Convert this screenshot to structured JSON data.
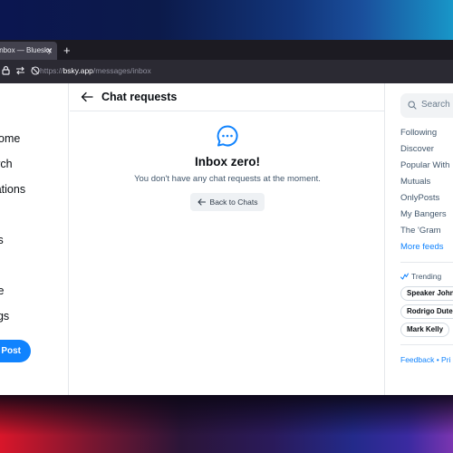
{
  "browser": {
    "tab_title": "Inbox — Bluesky",
    "tab_close": "✕",
    "new_tab": "+",
    "url_prefix": "https://",
    "url_domain": "bsky.app",
    "url_path": "/messages/inbox"
  },
  "leftnav": {
    "items": [
      {
        "label": "Home",
        "visible": "e"
      },
      {
        "label": "Search",
        "visible": "ch"
      },
      {
        "label": "Notifications",
        "visible": "ications"
      },
      {
        "label": "Feeds",
        "visible": "s"
      },
      {
        "label": "Profile",
        "visible": "le"
      },
      {
        "label": "Settings",
        "visible": "ngs"
      }
    ],
    "post_button": "Post"
  },
  "main": {
    "header_title": "Chat requests",
    "empty_title": "Inbox zero!",
    "empty_subtitle": "You don't have any chat requests at the moment.",
    "back_button": "Back to Chats"
  },
  "rightcol": {
    "search_placeholder": "Search",
    "feeds": [
      "Following",
      "Discover",
      "Popular With",
      "Mutuals",
      "OnlyPosts",
      "My Bangers",
      "The 'Gram"
    ],
    "more_feeds": "More feeds",
    "trending_label": "Trending",
    "trending": [
      "Speaker John",
      "Rodrigo Dute",
      "Mark Kelly"
    ],
    "footer": "Feedback • Pri"
  },
  "colors": {
    "accent": "#1083fe",
    "text": "#0b0f14",
    "muted": "#42576c"
  }
}
